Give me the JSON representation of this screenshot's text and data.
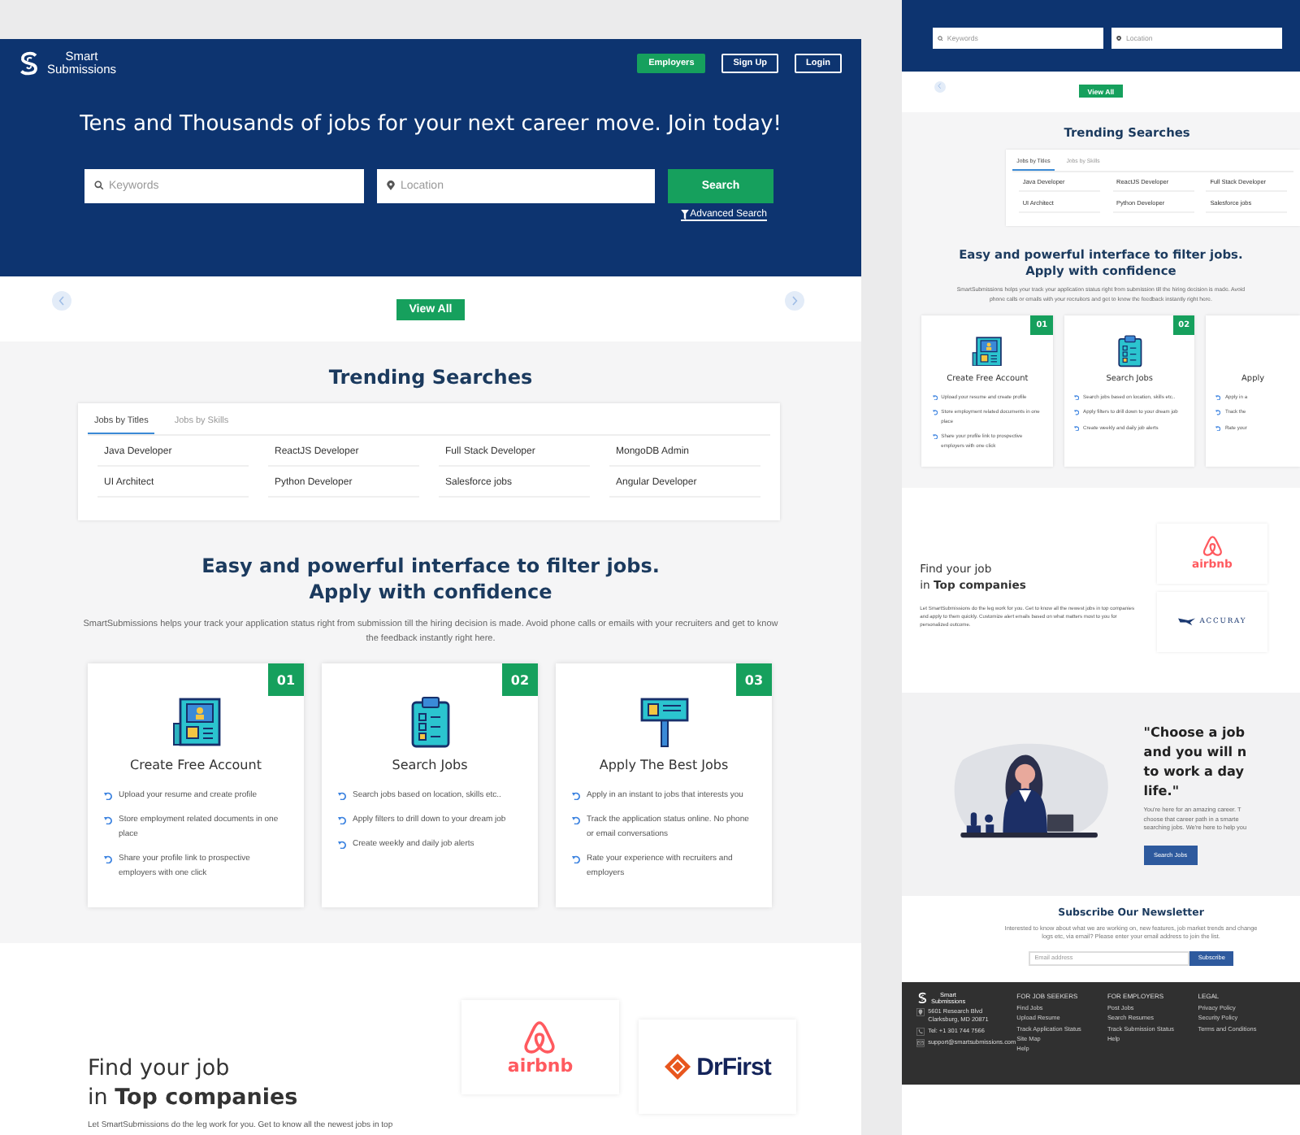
{
  "main_page": {
    "header": {
      "logo_lines": [
        "Smart",
        "Submissions"
      ],
      "nav": [
        {
          "label": "Employers",
          "kind": "primary"
        },
        {
          "label": "Sign Up",
          "kind": "outline"
        },
        {
          "label": "Login",
          "kind": "outline"
        }
      ]
    },
    "hero": {
      "headline": "Tens and Thousands of jobs for your next career move. Join today!",
      "keywords_placeholder": "Keywords",
      "location_placeholder": "Location",
      "search_button": "Search",
      "advanced_search": "Advanced Search"
    },
    "carousel": {
      "view_all": "View All",
      "previous_button": true,
      "next_button": true
    },
    "trending": {
      "title": "Trending Searches",
      "tabs": [
        {
          "label": "Jobs by Titles",
          "selected": true
        },
        {
          "label": "Jobs by Skills",
          "selected": false
        }
      ],
      "items": [
        "Java Developer",
        "ReactJS Developer",
        "Full Stack Developer",
        "MongoDB Admin",
        "UI Architect",
        "Python Developer",
        "Salesforce jobs",
        "Angular Developer"
      ]
    },
    "features": {
      "title_lines": [
        "Easy and powerful interface to filter jobs.",
        "Apply with confidence"
      ],
      "description": "SmartSubmissions helps your track your application status right from submission till the hiring decision is made. Avoid phone calls or emails with your recruiters and get to know the feedback instantly right here.",
      "cards": [
        {
          "number": "01",
          "kind": "profile",
          "title": "Create Free Account",
          "items": [
            "Upload your resume and create profile",
            "Store employment related documents in one place",
            "Share your profile link to prospective employers with one click"
          ]
        },
        {
          "number": "02",
          "kind": "clipboard",
          "title": "Search Jobs",
          "items": [
            "Search jobs based on location, skills etc..",
            "Apply filters to drill down to your dream job",
            "Create weekly and daily job alerts"
          ]
        },
        {
          "number": "03",
          "kind": "signboard",
          "title": "Apply The Best Jobs",
          "items": [
            "Apply in an instant to jobs that interests you",
            "Track the application status online. No phone or email conversations",
            "Rate your experience with recruiters and employers"
          ]
        }
      ]
    },
    "companies": {
      "title_lines": [
        "Find your job",
        "in **Top companies**"
      ],
      "description": "Let SmartSubmissions do the leg work for you. Get to know all the newest jobs in top",
      "logos": [
        {
          "name": "airbnb",
          "kind": "airbnb"
        },
        {
          "name": "DrFirst",
          "kind": "drfirst"
        }
      ]
    }
  },
  "preview_page": {
    "hero": {
      "keywords_placeholder": "Keywords",
      "location_placeholder": "Location"
    },
    "carousel": {
      "view_all": "View All",
      "previous_button": true,
      "next_button": false
    },
    "trending": {
      "title": "Trending Searches",
      "tabs": [
        {
          "label": "Jobs by Titles",
          "selected": true
        },
        {
          "label": "Jobs by Skills",
          "selected": false
        }
      ],
      "items": [
        "Java Developer",
        "ReactJS Developer",
        "Full Stack Developer",
        "UI Architect",
        "Python Developer",
        "Salesforce jobs"
      ]
    },
    "features": {
      "title_lines": [
        "Easy and powerful interface to filter jobs.",
        "Apply with confidence"
      ],
      "description": "SmartSubmissions helps your track your application status right from submission till the hiring decision is made. Avoid phone calls or emails with your recruiters and get to know the feedback instantly right here.",
      "cards": [
        {
          "number": "01",
          "kind": "profile",
          "title": "Create Free Account",
          "items": [
            "Upload your resume and create profile",
            "Store employment related documents in one place",
            "Share your profile link to prospective employers with one click"
          ]
        },
        {
          "number": "02",
          "kind": "clipboard",
          "title": "Search Jobs",
          "items": [
            "Search jobs based on location, skills etc..",
            "Apply filters to drill down to your dream job",
            "Create weekly and daily job alerts"
          ]
        },
        {
          "title": "Apply",
          "items": [
            "Apply in a",
            "Track the",
            "Rate your"
          ]
        }
      ]
    },
    "companies": {
      "title_lines": [
        "Find your job",
        "in **Top companies**"
      ],
      "description": "Let SmartSubmissions do the leg work for you. Get to know all the newest jobs in top companies and apply to them quickly. Customize alert emails based on what matters most to you for personalized outcome.",
      "logos": [
        {
          "name": "airbnb",
          "kind": "airbnb"
        },
        {
          "name": "ACCURAY",
          "kind": "accuray"
        }
      ]
    },
    "quote": {
      "lines": [
        "\"Choose a job",
        "and you will n",
        "to work a day",
        "life.\""
      ],
      "text_lines": [
        "You're here for an amazing career. T",
        "choose that career path in a smarte",
        "searching jobs. We're here to help you"
      ],
      "button": "Search Jobs"
    },
    "newsletter": {
      "title": "Subscribe Our Newsletter",
      "description": "Interested to know about what we are working on, new features, job market trends and change logs etc, via email? Please enter your email address to join the list.",
      "placeholder": "Email address",
      "button": "Subscribe"
    },
    "footer": {
      "logo_lines": [
        "Smart",
        "Submissions"
      ],
      "contacts": [
        {
          "kind": "address",
          "text": "5601 Research Blvd Clarksburg, MD 20871"
        },
        {
          "kind": "phone",
          "text": "Tel: +1 301 744 7566"
        },
        {
          "kind": "email",
          "text": "support@smartsubmissions.com"
        }
      ],
      "columns": [
        {
          "heading": "FOR JOB SEEKERS",
          "links": [
            "Find Jobs",
            "Upload Resume",
            "Track Application Status",
            "Site Map",
            "Help"
          ]
        },
        {
          "heading": "FOR EMPLOYERS",
          "links": [
            "Post Jobs",
            "Search Resumes",
            "Track Submission Status",
            "Help"
          ]
        },
        {
          "heading": "LEGAL",
          "links": [
            "Privacy Policy",
            "Security Policy",
            "Terms and Conditions"
          ]
        }
      ]
    }
  }
}
